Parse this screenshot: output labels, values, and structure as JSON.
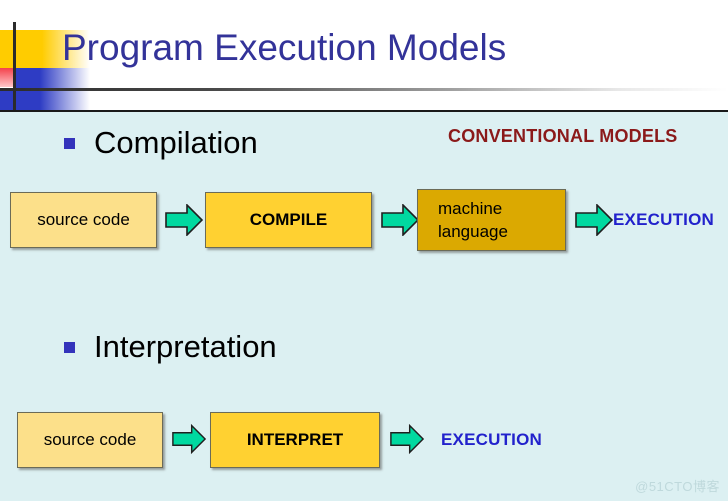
{
  "slide": {
    "title": "Program Execution Models",
    "background_color": "#DCF0F2",
    "title_color": "#333399"
  },
  "sections": [
    {
      "bullet_label": "Compilation",
      "aside_label": "CONVENTIONAL MODELS",
      "aside_color": "#8B1A1A",
      "steps": [
        {
          "label": "source code",
          "kind": "box",
          "fill": "#FCE08A"
        },
        {
          "label": "arrow-right",
          "kind": "arrow",
          "fill": "#00D9A0"
        },
        {
          "label": "COMPILE",
          "kind": "box",
          "fill": "#FFD131"
        },
        {
          "label": "arrow-right",
          "kind": "arrow",
          "fill": "#00D9A0"
        },
        {
          "label": "machine language",
          "kind": "box",
          "fill": "#DBA901"
        },
        {
          "label": "arrow-right",
          "kind": "arrow",
          "fill": "#00D9A0"
        },
        {
          "label": "EXECUTION",
          "kind": "text",
          "fill": "#2222CC"
        }
      ]
    },
    {
      "bullet_label": "Interpretation",
      "aside_label": "",
      "steps": [
        {
          "label": "source code",
          "kind": "box",
          "fill": "#FCE08A"
        },
        {
          "label": "arrow-right",
          "kind": "arrow",
          "fill": "#00D9A0"
        },
        {
          "label": "INTERPRET",
          "kind": "box",
          "fill": "#FFD131"
        },
        {
          "label": "arrow-right",
          "kind": "arrow",
          "fill": "#00D9A0"
        },
        {
          "label": "EXECUTION",
          "kind": "text",
          "fill": "#2222CC"
        }
      ]
    }
  ],
  "watermark": "@51CTO博客",
  "boxes": {
    "row1_source_code": "source code",
    "row1_compile": "COMPILE",
    "row1_machine_line1": "machine",
    "row1_machine_line2": "language",
    "row1_execution": "EXECUTION",
    "row2_source_code": "source code",
    "row2_interpret": "INTERPRET",
    "row2_execution": "EXECUTION"
  },
  "bullets": {
    "compilation": "Compilation",
    "interpretation": "Interpretation",
    "conventional_models": "CONVENTIONAL MODELS"
  }
}
